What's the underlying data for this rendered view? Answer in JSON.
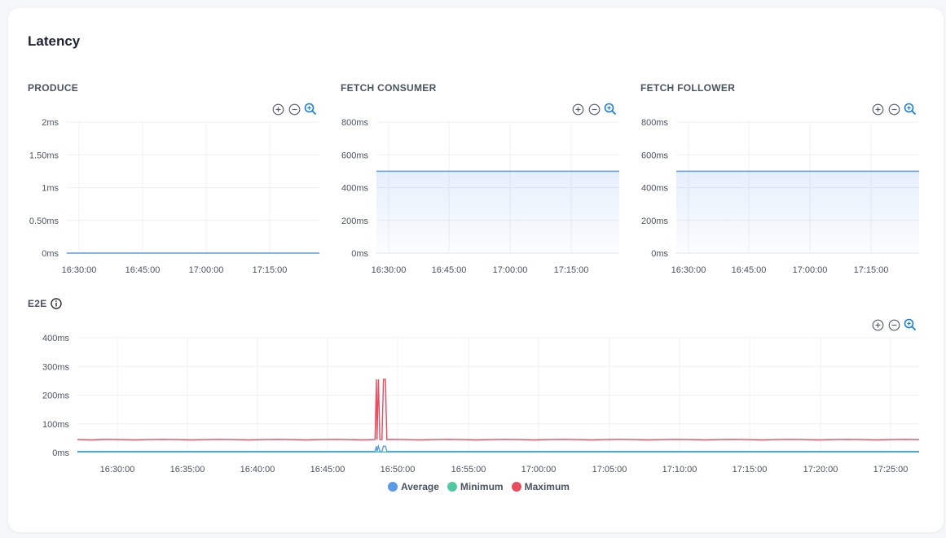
{
  "page": {
    "title": "Latency"
  },
  "icons": {
    "zoom_in": "plus-circle-icon",
    "zoom_out": "minus-circle-icon",
    "reset": "magnify-icon",
    "info": "info-icon"
  },
  "charts": {
    "produce": {
      "title": "PRODUCE"
    },
    "fetch_consumer": {
      "title": "FETCH CONSUMER"
    },
    "fetch_follower": {
      "title": "FETCH FOLLOWER"
    },
    "e2e": {
      "title": "E2E"
    }
  },
  "colors": {
    "average": "#5b9be6",
    "minimum": "#4fc9a0",
    "maximum": "#e84d60",
    "area": "#5b9be6",
    "grid": "#eef0f3",
    "axis": "#dfe3e8"
  },
  "chart_data": [
    {
      "type": "area",
      "title": "PRODUCE",
      "y_ticks": [
        "0ms",
        "0.50ms",
        "1ms",
        "1.50ms",
        "2ms"
      ],
      "ylim": [
        0,
        2
      ],
      "x_ticks": [
        "16:30:00",
        "16:45:00",
        "17:00:00",
        "17:15:00"
      ],
      "series": [
        {
          "values": [
            0,
            0,
            0,
            0,
            0,
            0,
            0,
            0,
            0,
            0
          ]
        }
      ]
    },
    {
      "type": "area",
      "title": "FETCH CONSUMER",
      "y_ticks": [
        "0ms",
        "200ms",
        "400ms",
        "600ms",
        "800ms"
      ],
      "ylim": [
        0,
        800
      ],
      "x_ticks": [
        "16:30:00",
        "16:45:00",
        "17:00:00",
        "17:15:00"
      ],
      "series": [
        {
          "values": [
            500,
            500,
            500,
            500,
            500,
            500,
            500,
            500,
            500,
            500
          ]
        }
      ]
    },
    {
      "type": "area",
      "title": "FETCH FOLLOWER",
      "y_ticks": [
        "0ms",
        "200ms",
        "400ms",
        "600ms",
        "800ms"
      ],
      "ylim": [
        0,
        800
      ],
      "x_ticks": [
        "16:30:00",
        "16:45:00",
        "17:00:00",
        "17:15:00"
      ],
      "series": [
        {
          "values": [
            500,
            500,
            500,
            500,
            500,
            500,
            500,
            500,
            500,
            500
          ]
        }
      ]
    },
    {
      "type": "line",
      "title": "E2E",
      "y_ticks": [
        "0ms",
        "100ms",
        "200ms",
        "300ms",
        "400ms"
      ],
      "ylim": [
        0,
        400
      ],
      "x_ticks": [
        "16:30:00",
        "16:35:00",
        "16:40:00",
        "16:45:00",
        "16:50:00",
        "16:55:00",
        "17:00:00",
        "17:05:00",
        "17:10:00",
        "17:15:00",
        "17:20:00",
        "17:25:00"
      ],
      "legend": [
        "Average",
        "Minimum",
        "Maximum"
      ],
      "series": [
        {
          "name": "Average",
          "values": [
            4,
            4,
            4,
            4,
            4,
            4,
            4,
            4,
            4,
            4,
            4,
            4,
            4,
            4,
            4,
            4,
            4,
            4,
            4,
            4,
            4,
            4,
            4,
            4,
            4,
            4,
            4,
            4,
            4,
            4,
            4,
            4,
            4,
            4,
            4,
            4,
            4,
            4,
            4,
            4,
            4,
            4,
            4,
            4,
            4,
            4,
            4,
            4,
            4,
            4,
            4,
            4,
            4,
            4,
            4,
            4,
            4,
            4,
            4,
            4
          ]
        },
        {
          "name": "Minimum",
          "values": [
            2,
            2,
            2,
            2,
            2,
            2,
            2,
            2,
            2,
            2,
            2,
            2,
            2,
            2,
            2,
            2,
            2,
            2,
            2,
            2,
            2,
            2,
            2,
            2,
            2,
            2,
            2,
            2,
            2,
            2,
            2,
            2,
            2,
            2,
            2,
            2,
            2,
            2,
            2,
            2,
            2,
            2,
            2,
            2,
            2,
            2,
            2,
            2,
            2,
            2,
            2,
            2,
            2,
            2,
            2,
            2,
            2,
            2,
            2,
            2
          ]
        },
        {
          "name": "Maximum",
          "values": [
            45,
            44,
            46,
            45,
            44,
            45,
            46,
            45,
            44,
            45,
            46,
            45,
            44,
            45,
            46,
            45,
            44,
            45,
            46,
            45,
            44,
            45,
            46,
            45,
            44,
            45,
            46,
            45,
            44,
            45,
            46,
            45,
            44,
            45,
            46,
            45,
            44,
            45,
            46,
            45,
            44,
            45,
            46,
            45,
            44,
            45,
            46,
            45,
            44,
            45,
            46,
            45,
            44,
            45,
            46,
            45,
            44,
            45,
            46,
            45
          ]
        }
      ],
      "spikes": [
        {
          "series": "Maximum",
          "at": "16:48:30",
          "value": 255
        },
        {
          "series": "Maximum",
          "at": "16:49:00",
          "value": 255
        },
        {
          "series": "Average",
          "at": "16:48:30",
          "value": 22
        },
        {
          "series": "Average",
          "at": "16:49:00",
          "value": 22
        }
      ]
    }
  ]
}
